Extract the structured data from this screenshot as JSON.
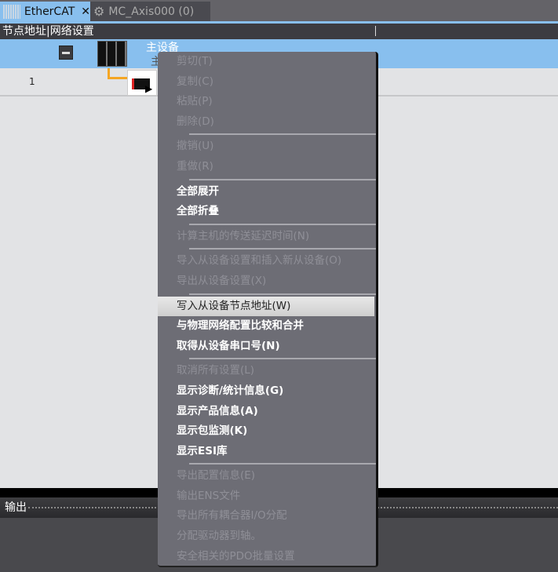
{
  "tabs": [
    {
      "label": "EtherCAT",
      "close": "✕",
      "active": true
    },
    {
      "label": "MC_Axis000 (0)",
      "active": false
    }
  ],
  "header": {
    "title": "节点地址|网络设置"
  },
  "tree": {
    "master_label": "主设备",
    "master_sub": "主",
    "row_number": "1"
  },
  "context_menu": {
    "groups": [
      [
        {
          "label": "剪切(T)",
          "enabled": false
        },
        {
          "label": "复制(C)",
          "enabled": false
        },
        {
          "label": "粘贴(P)",
          "enabled": false
        },
        {
          "label": "删除(D)",
          "enabled": false
        }
      ],
      [
        {
          "label": "撤销(U)",
          "enabled": false
        },
        {
          "label": "重做(R)",
          "enabled": false
        }
      ],
      [
        {
          "label": "全部展开",
          "enabled": true
        },
        {
          "label": "全部折叠",
          "enabled": true
        }
      ],
      [
        {
          "label": "计算主机的传送延迟时间(N)",
          "enabled": false
        }
      ],
      [
        {
          "label": "导入从设备设置和插入新从设备(O)",
          "enabled": false
        },
        {
          "label": "导出从设备设置(X)",
          "enabled": false
        }
      ],
      [
        {
          "label": "写入从设备节点地址(W)",
          "enabled": true,
          "highlighted": true
        },
        {
          "label": "与物理网络配置比较和合并",
          "enabled": true
        },
        {
          "label": "取得从设备串口号(N)",
          "enabled": true
        }
      ],
      [
        {
          "label": "取消所有设置(L)",
          "enabled": false
        },
        {
          "label": "显示诊断/统计信息(G)",
          "enabled": true
        },
        {
          "label": "显示产品信息(A)",
          "enabled": true
        },
        {
          "label": "显示包监测(K)",
          "enabled": true
        },
        {
          "label": "显示ESI库",
          "enabled": true
        }
      ],
      [
        {
          "label": "导出配置信息(E)",
          "enabled": false
        },
        {
          "label": "输出ENS文件",
          "enabled": false
        },
        {
          "label": "导出所有耦合器I/O分配",
          "enabled": false
        },
        {
          "label": "分配驱动器到轴。",
          "enabled": false
        },
        {
          "label": "安全相关的PDO批量设置",
          "enabled": false
        }
      ]
    ]
  },
  "output": {
    "title": "输出"
  },
  "colors": {
    "accent": "#88bfee",
    "menu_bg": "#6d6d75",
    "header_bg": "#3c3c41"
  }
}
